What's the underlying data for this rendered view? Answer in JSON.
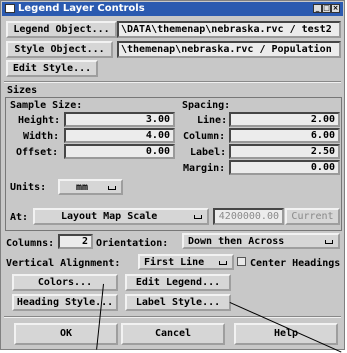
{
  "window": {
    "title": "Legend Layer Controls"
  },
  "legend_object": {
    "button": "Legend Object...",
    "path": "\\DATA\\themenap\\nebraska.rvc / test2"
  },
  "style_object": {
    "button": "Style Object...",
    "path": "\\themenap\\nebraska.rvc / Population"
  },
  "edit_style": {
    "button": "Edit Style..."
  },
  "sizes": {
    "label": "Sizes",
    "sample_size": {
      "label": "Sample Size:",
      "height_label": "Height:",
      "height": "3.00",
      "width_label": "Width:",
      "width": "4.00",
      "offset_label": "Offset:",
      "offset": "0.00"
    },
    "spacing": {
      "label": "Spacing:",
      "line_label": "Line:",
      "line": "2.00",
      "column_label": "Column:",
      "column": "6.00",
      "label_label": "Label:",
      "label_value": "2.50",
      "margin_label": "Margin:",
      "margin": "0.00"
    },
    "units": {
      "label": "Units:",
      "value": "mm"
    },
    "at": {
      "label": "At:",
      "value": "Layout Map Scale",
      "scale": "4200000.00",
      "current_button": "Current"
    }
  },
  "columns": {
    "label": "Columns:",
    "value": "2",
    "orientation_label": "Orientation:",
    "orientation_value": "Down then Across"
  },
  "vertical_alignment": {
    "label": "Vertical Alignment:",
    "value": "First Line",
    "center_headings": "Center Headings"
  },
  "buttons": {
    "colors": "Colors...",
    "edit_legend": "Edit Legend...",
    "heading_style": "Heading Style...",
    "label_style": "Label Style..."
  },
  "dialog": {
    "ok": "OK",
    "cancel": "Cancel",
    "help": "Help"
  },
  "colors": {
    "titlebar": "#2b5ab0",
    "window": "#c8c8c8"
  }
}
